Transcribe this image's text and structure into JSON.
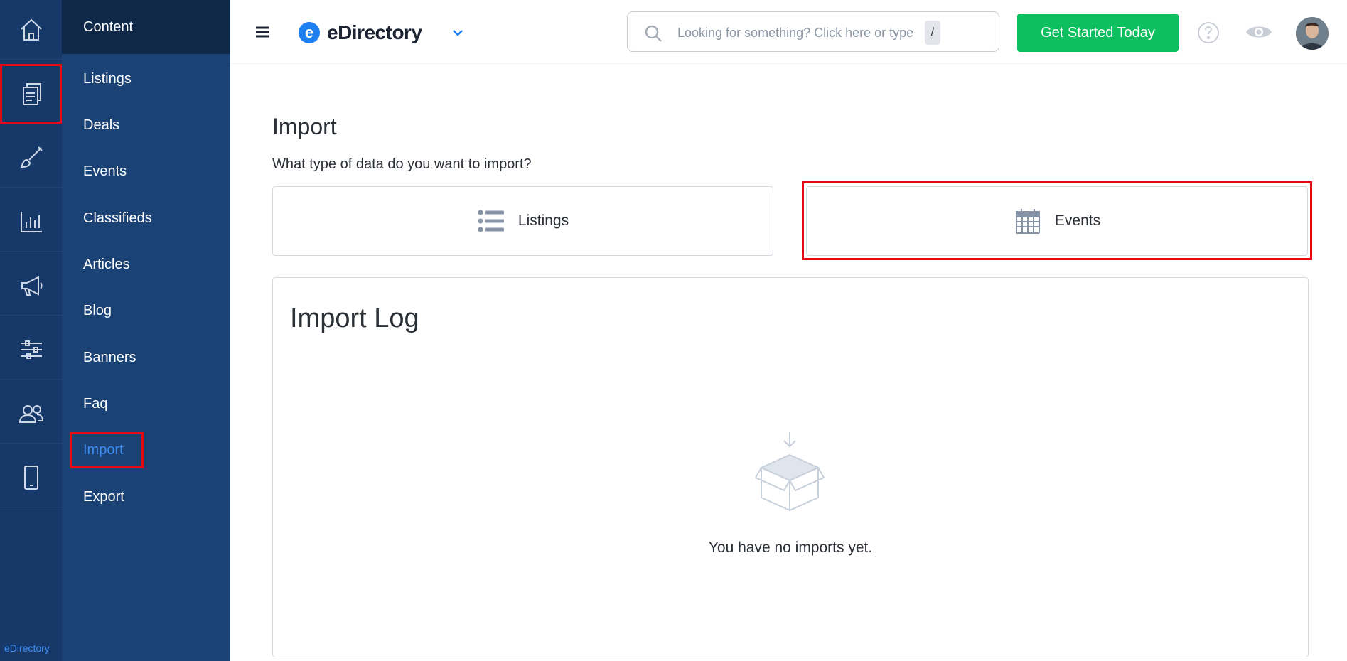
{
  "app": {
    "name": "eDirectory"
  },
  "rail": {
    "items": [
      {
        "icon": "home-icon"
      },
      {
        "icon": "content-pages-icon",
        "selected": true
      },
      {
        "icon": "paintbrush-icon"
      },
      {
        "icon": "bar-chart-icon"
      },
      {
        "icon": "megaphone-icon"
      },
      {
        "icon": "sliders-icon"
      },
      {
        "icon": "users-icon"
      },
      {
        "icon": "mobile-icon"
      }
    ],
    "brand": "eDirectory"
  },
  "subnav": {
    "header": "Content",
    "items": [
      {
        "label": "Listings"
      },
      {
        "label": "Deals"
      },
      {
        "label": "Events"
      },
      {
        "label": "Classifieds"
      },
      {
        "label": "Articles"
      },
      {
        "label": "Blog"
      },
      {
        "label": "Banners"
      },
      {
        "label": "Faq"
      },
      {
        "label": "Import",
        "active": true
      },
      {
        "label": "Export"
      }
    ]
  },
  "topbar": {
    "logo_letter": "e",
    "logo_text": "eDirectory",
    "search_placeholder": "Looking for something? Click here or type",
    "search_shortcut": "/",
    "cta_label": "Get Started Today"
  },
  "main": {
    "title": "Import",
    "prompt": "What type of data do you want to import?",
    "types": [
      {
        "label": "Listings",
        "icon": "list-icon"
      },
      {
        "label": "Events",
        "icon": "calendar-icon"
      }
    ],
    "log": {
      "title": "Import Log",
      "empty_message": "You have no imports yet."
    }
  },
  "colors": {
    "rail_bg": "#17396a",
    "subnav_bg": "#1b4275",
    "subnav_header_bg": "#0f2848",
    "accent": "#3d8ff5",
    "cta": "#0ebf5f",
    "highlight": "#e50914"
  }
}
